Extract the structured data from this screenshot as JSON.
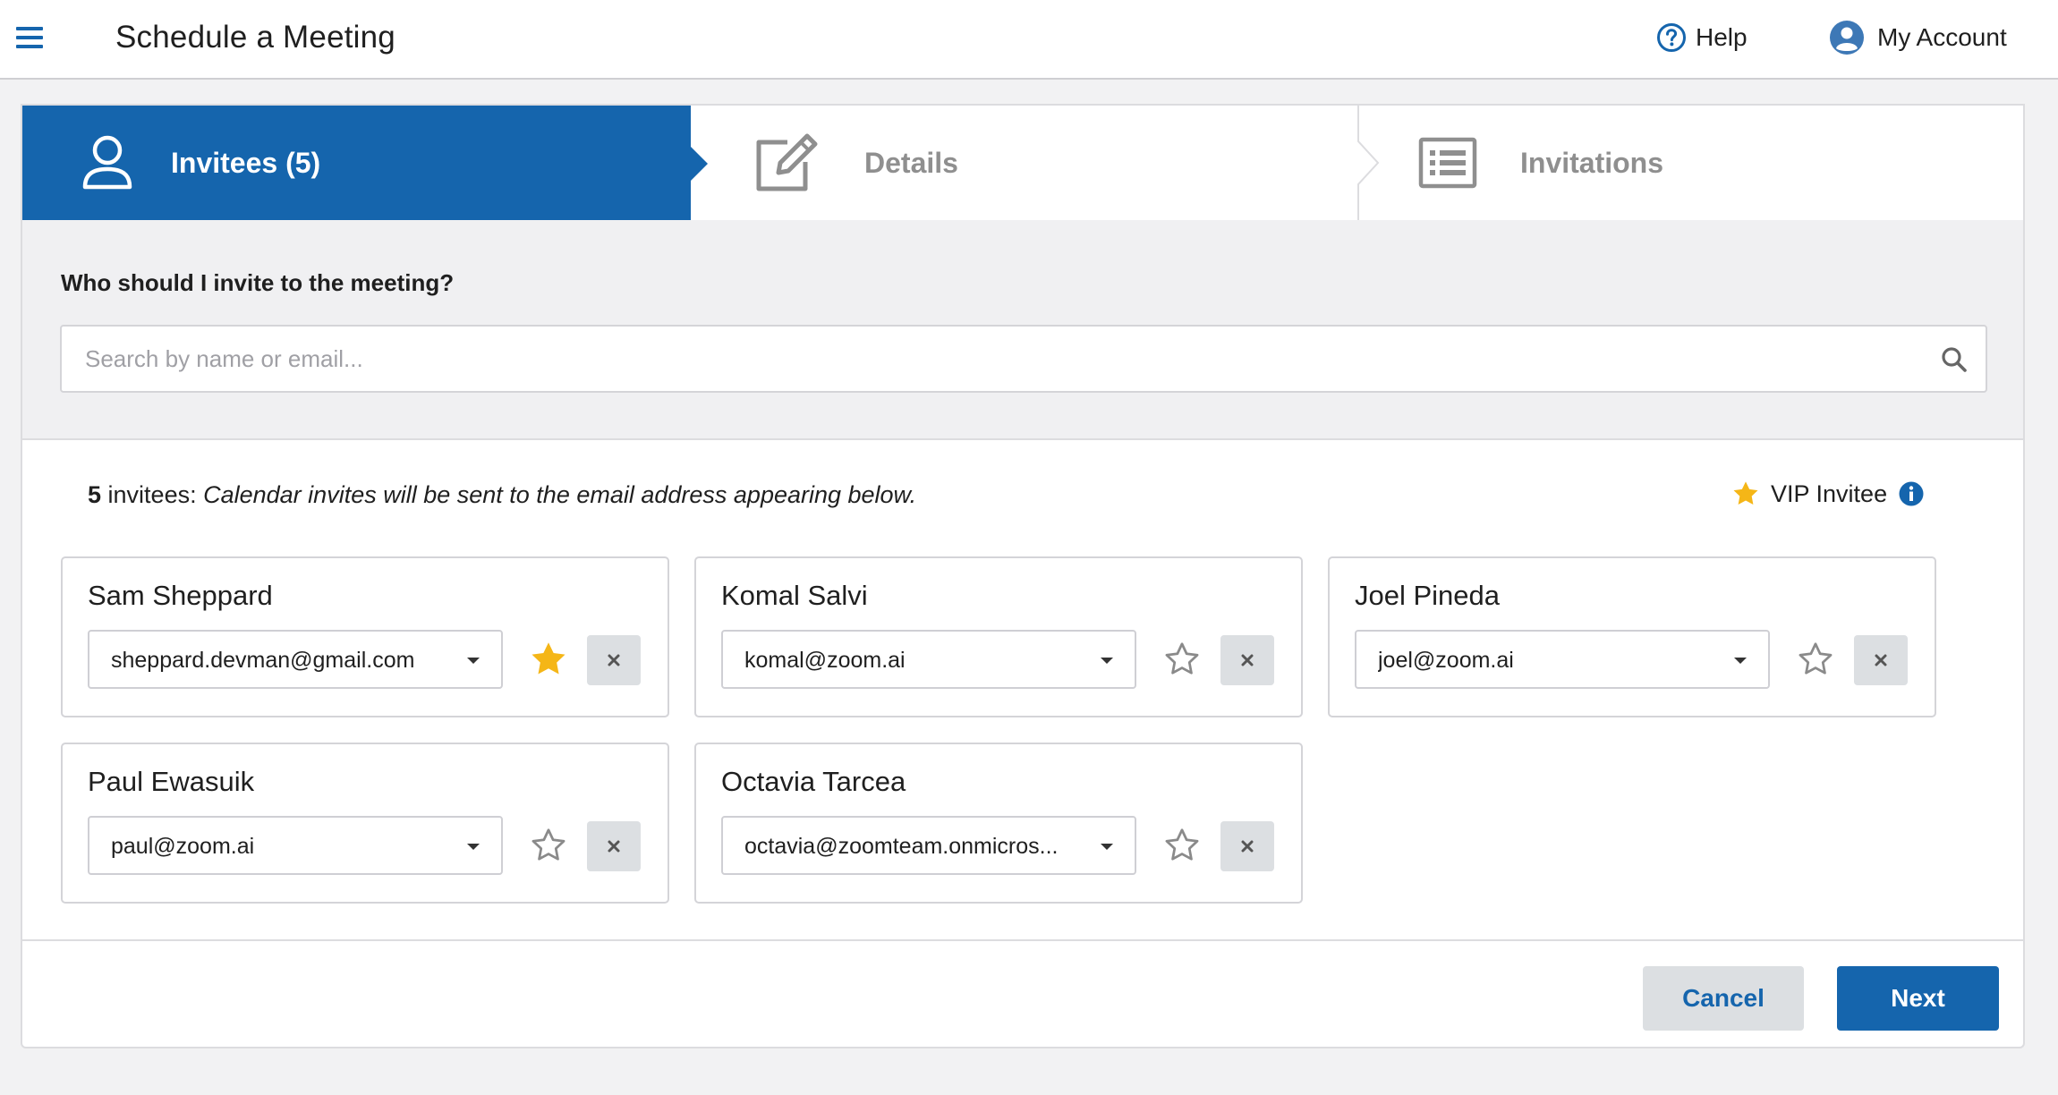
{
  "header": {
    "title": "Schedule a Meeting",
    "help_label": "Help",
    "account_label": "My Account"
  },
  "steps": [
    {
      "label": "Invitees (5)",
      "icon": "user-icon",
      "active": true
    },
    {
      "label": "Details",
      "icon": "edit-icon",
      "active": false
    },
    {
      "label": "Invitations",
      "icon": "list-icon",
      "active": false
    }
  ],
  "search": {
    "question": "Who should I invite to the meeting?",
    "placeholder": "Search by name or email..."
  },
  "summary": {
    "count": "5",
    "count_suffix": " invitees:",
    "note": "Calendar invites will be sent to the email address appearing below."
  },
  "vip_legend": {
    "label": "VIP Invitee"
  },
  "invitees": [
    {
      "name": "Sam Sheppard",
      "email": "sheppard.devman@gmail.com",
      "vip": true
    },
    {
      "name": "Komal Salvi",
      "email": "komal@zoom.ai",
      "vip": false
    },
    {
      "name": "Joel Pineda",
      "email": "joel@zoom.ai",
      "vip": false
    },
    {
      "name": "Paul Ewasuik",
      "email": "paul@zoom.ai",
      "vip": false
    },
    {
      "name": "Octavia Tarcea",
      "email": "octavia@zoomteam.onmicros...",
      "vip": false
    }
  ],
  "footer": {
    "cancel_label": "Cancel",
    "next_label": "Next"
  },
  "colors": {
    "primary": "#1565ad",
    "vip_star": "#f5b617",
    "inactive_step_text": "#8f8f8f",
    "panel_gray": "#f0f0f2"
  }
}
